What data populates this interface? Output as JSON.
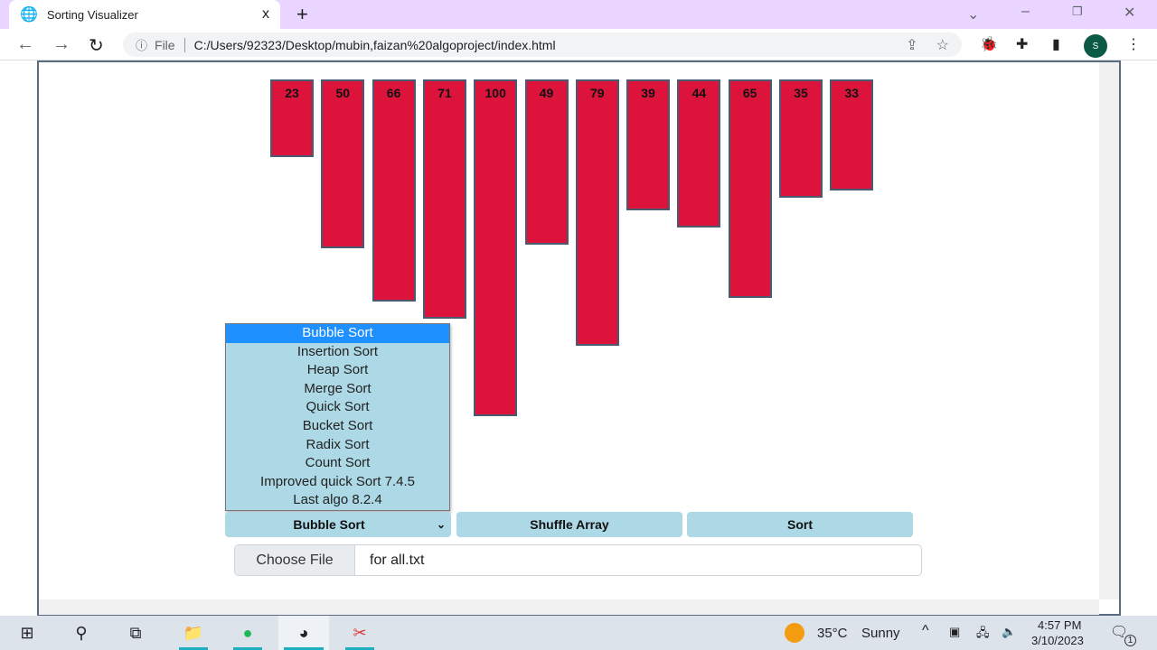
{
  "browser": {
    "tab_title": "Sorting Visualizer",
    "new_tab": "+",
    "close": "x",
    "address_prefix": "File",
    "url": "C:/Users/92323/Desktop/mubin,faizan%20algoproject/index.html",
    "profile": "S"
  },
  "bars": [
    23,
    50,
    66,
    71,
    100,
    49,
    79,
    39,
    44,
    65,
    35,
    33
  ],
  "colors": {
    "bar": "#dc143c",
    "button": "#add8e6",
    "selected": "#1e90ff"
  },
  "dropdown": {
    "options": [
      "Bubble Sort",
      "Insertion Sort",
      "Heap Sort",
      "Merge Sort",
      "Quick Sort",
      "Bucket Sort",
      "Radix Sort",
      "Count Sort",
      "Improved quick Sort 7.4.5",
      "Last algo 8.2.4"
    ],
    "selected": "Bubble Sort"
  },
  "buttons": {
    "shuffle": "Shuffle Array",
    "sort": "Sort"
  },
  "file": {
    "button": "Choose File",
    "name": "for all.txt"
  },
  "taskbar": {
    "temp": "35°C",
    "weather": "Sunny",
    "time": "4:57 PM",
    "date": "3/10/2023",
    "notif": "1"
  }
}
